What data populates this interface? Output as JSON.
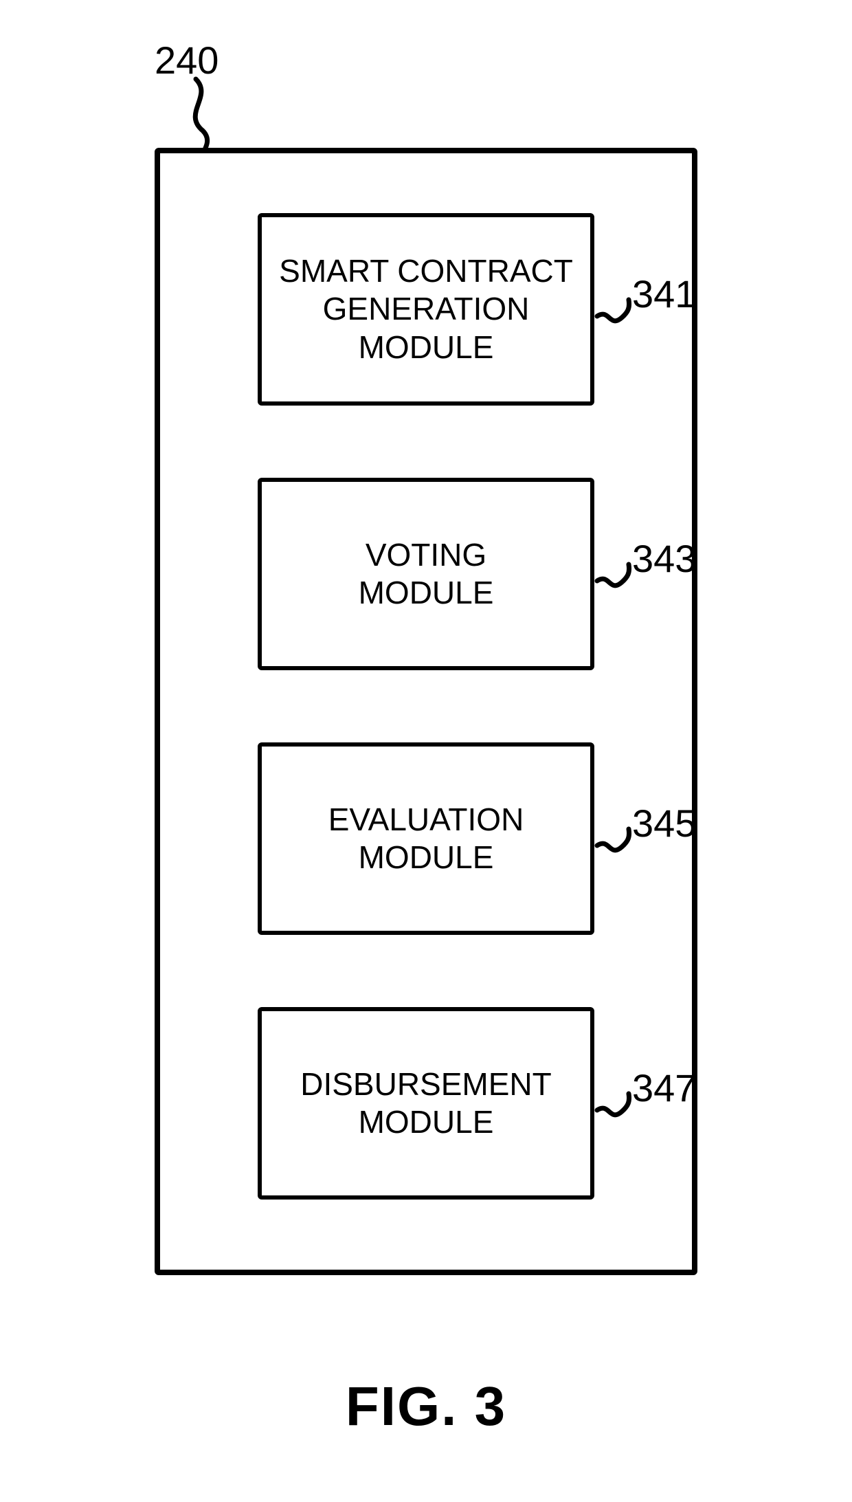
{
  "outer_ref": "240",
  "modules": [
    {
      "id": "m1",
      "text": "SMART CONTRACT\nGENERATION\nMODULE",
      "ref": "341"
    },
    {
      "id": "m2",
      "text": "VOTING\nMODULE",
      "ref": "343"
    },
    {
      "id": "m3",
      "text": "EVALUATION\nMODULE",
      "ref": "345"
    },
    {
      "id": "m4",
      "text": "DISBURSEMENT\nMODULE",
      "ref": "347"
    }
  ],
  "figure_caption": "FIG. 3"
}
